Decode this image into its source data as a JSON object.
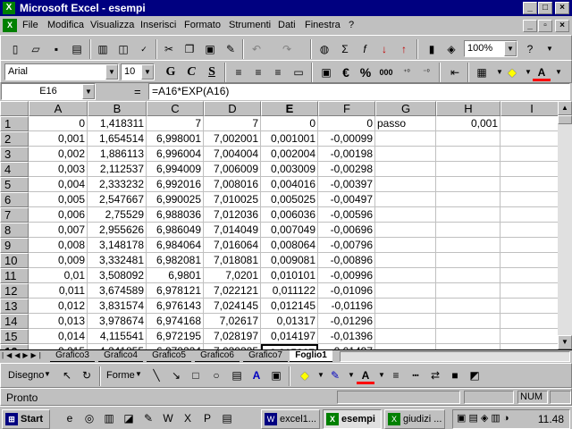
{
  "window": {
    "title": "Microsoft Excel - esempi"
  },
  "menu": [
    "File",
    "Modifica",
    "Visualizza",
    "Inserisci",
    "Formato",
    "Strumenti",
    "Dati",
    "Finestra",
    "?"
  ],
  "standard_toolbar": {
    "zoom": "100%"
  },
  "format_toolbar": {
    "font": "Arial",
    "size": "10",
    "bold": "G",
    "italic": "C",
    "underline": "S",
    "currency": "€",
    "percent": "%",
    "thousands": "000"
  },
  "formula_bar": {
    "name_box": "E16",
    "equals": "=",
    "formula": "=A16*EXP(A16)"
  },
  "sheet": {
    "columns": [
      "A",
      "B",
      "C",
      "D",
      "E",
      "F",
      "G",
      "H",
      "I"
    ],
    "rows": [
      {
        "n": "1",
        "cells": [
          "0",
          "1,418311",
          "7",
          "7",
          "0",
          "0",
          "passo",
          "0,001",
          ""
        ]
      },
      {
        "n": "2",
        "cells": [
          "0,001",
          "1,654514",
          "6,998001",
          "7,002001",
          "0,001001",
          "-0,00099",
          "",
          "",
          ""
        ]
      },
      {
        "n": "3",
        "cells": [
          "0,002",
          "1,886113",
          "6,996004",
          "7,004004",
          "0,002004",
          "-0,00198",
          "",
          "",
          ""
        ]
      },
      {
        "n": "4",
        "cells": [
          "0,003",
          "2,112537",
          "6,994009",
          "7,006009",
          "0,003009",
          "-0,00298",
          "",
          "",
          ""
        ]
      },
      {
        "n": "5",
        "cells": [
          "0,004",
          "2,333232",
          "6,992016",
          "7,008016",
          "0,004016",
          "-0,00397",
          "",
          "",
          ""
        ]
      },
      {
        "n": "6",
        "cells": [
          "0,005",
          "2,547667",
          "6,990025",
          "7,010025",
          "0,005025",
          "-0,00497",
          "",
          "",
          ""
        ]
      },
      {
        "n": "7",
        "cells": [
          "0,006",
          "2,75529",
          "6,988036",
          "7,012036",
          "0,006036",
          "-0,00596",
          "",
          "",
          ""
        ]
      },
      {
        "n": "8",
        "cells": [
          "0,007",
          "2,955626",
          "6,986049",
          "7,014049",
          "0,007049",
          "-0,00696",
          "",
          "",
          ""
        ]
      },
      {
        "n": "9",
        "cells": [
          "0,008",
          "3,148178",
          "6,984064",
          "7,016064",
          "0,008064",
          "-0,00796",
          "",
          "",
          ""
        ]
      },
      {
        "n": "10",
        "cells": [
          "0,009",
          "3,332481",
          "6,982081",
          "7,018081",
          "0,009081",
          "-0,00896",
          "",
          "",
          ""
        ]
      },
      {
        "n": "11",
        "cells": [
          "0,01",
          "3,508092",
          "6,9801",
          "7,0201",
          "0,010101",
          "-0,00996",
          "",
          "",
          ""
        ]
      },
      {
        "n": "12",
        "cells": [
          "0,011",
          "3,674589",
          "6,978121",
          "7,022121",
          "0,011122",
          "-0,01096",
          "",
          "",
          ""
        ]
      },
      {
        "n": "13",
        "cells": [
          "0,012",
          "3,831574",
          "6,976143",
          "7,024145",
          "0,012145",
          "-0,01196",
          "",
          "",
          ""
        ]
      },
      {
        "n": "14",
        "cells": [
          "0,013",
          "3,978674",
          "6,974168",
          "7,02617",
          "0,01317",
          "-0,01296",
          "",
          "",
          ""
        ]
      },
      {
        "n": "15",
        "cells": [
          "0,014",
          "4,115541",
          "6,972195",
          "7,028197",
          "0,014197",
          "-0,01396",
          "",
          "",
          ""
        ]
      },
      {
        "n": "16",
        "cells": [
          "0,015",
          "4,241855",
          "6,970224",
          "7,030225",
          "0,015227",
          "-0,01497",
          "",
          "",
          ""
        ]
      }
    ]
  },
  "tabs": [
    "Grafico3",
    "Grafico4",
    "Grafico5",
    "Grafico6",
    "Grafico7",
    "Foglio1"
  ],
  "active_tab": "Foglio1",
  "drawing": {
    "draw_label": "Disegno",
    "shapes_label": "Forme"
  },
  "status": {
    "text": "Pronto",
    "num": "NUM"
  },
  "taskbar": {
    "start": "Start",
    "tasks": [
      "excel1...",
      "esempi",
      "giudizi ..."
    ],
    "clock": "11.48"
  }
}
